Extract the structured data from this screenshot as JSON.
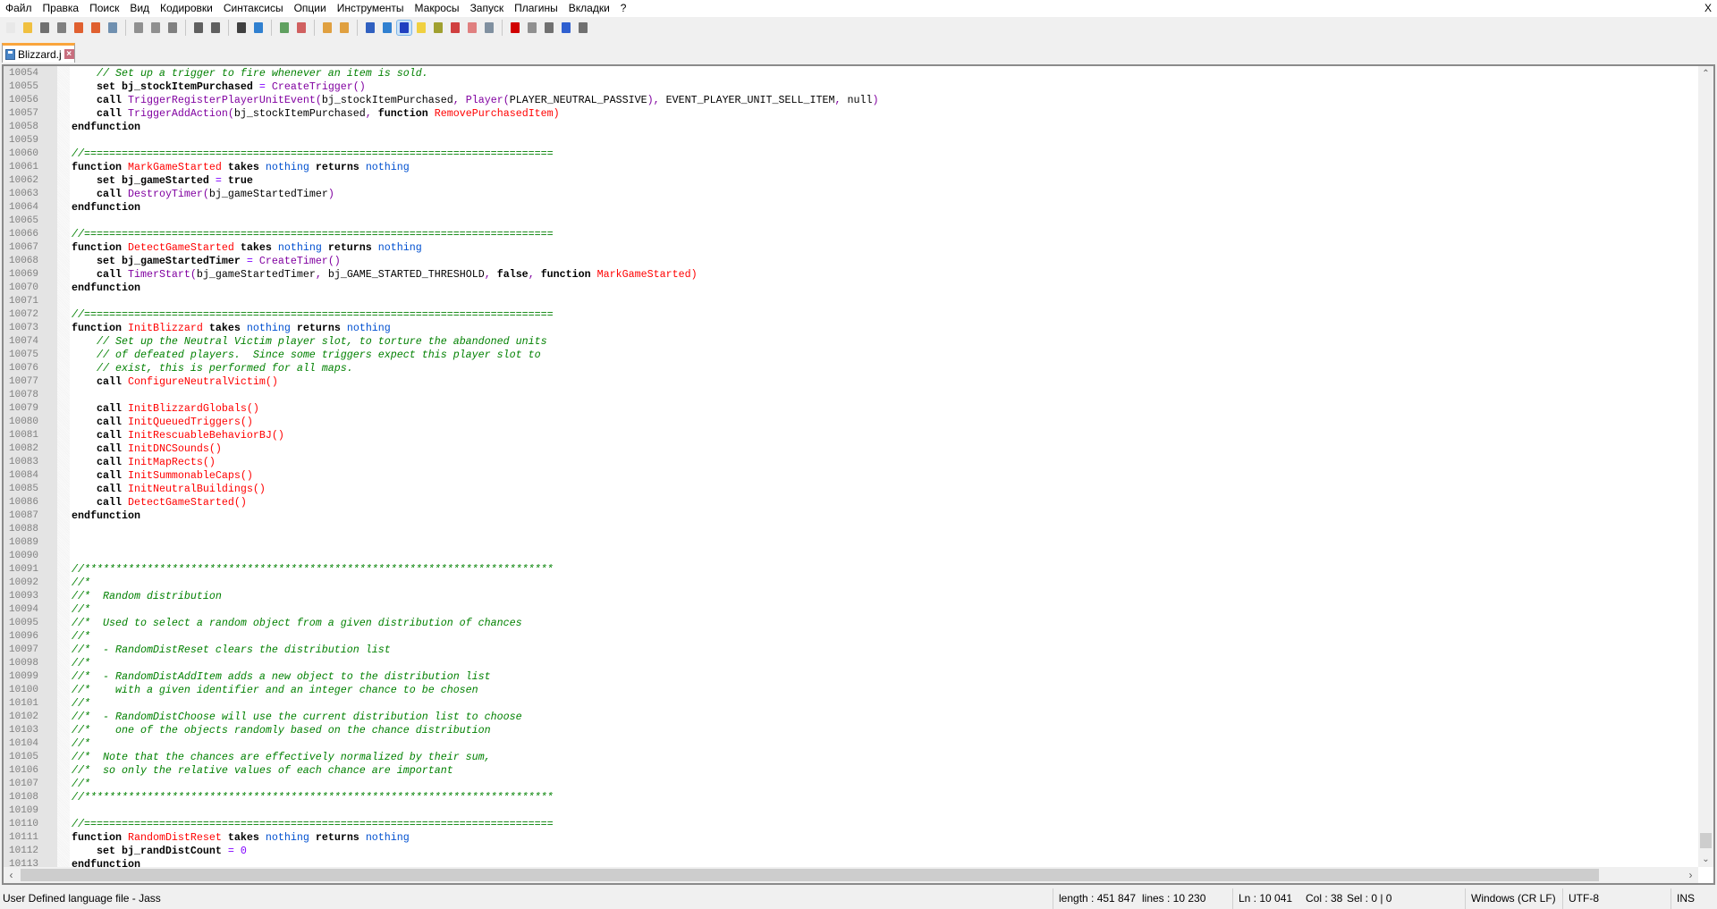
{
  "menu": [
    "Файл",
    "Правка",
    "Поиск",
    "Вид",
    "Кодировки",
    "Синтаксисы",
    "Опции",
    "Инструменты",
    "Макросы",
    "Запуск",
    "Плагины",
    "Вкладки",
    "?"
  ],
  "close_label": "X",
  "toolbar": [
    {
      "icon": "new-file-icon",
      "color": "#e8e8e8"
    },
    {
      "icon": "open-file-icon",
      "color": "#f0c040"
    },
    {
      "icon": "save-icon",
      "color": "#707070"
    },
    {
      "icon": "save-all-icon",
      "color": "#808080"
    },
    {
      "icon": "close-icon",
      "color": "#e06030"
    },
    {
      "icon": "close-all-icon",
      "color": "#e06030"
    },
    {
      "icon": "print-icon",
      "color": "#7090b0"
    },
    null,
    {
      "icon": "cut-icon",
      "color": "#909090"
    },
    {
      "icon": "copy-icon",
      "color": "#909090"
    },
    {
      "icon": "paste-icon",
      "color": "#808080"
    },
    null,
    {
      "icon": "undo-icon",
      "color": "#606060"
    },
    {
      "icon": "redo-icon",
      "color": "#606060"
    },
    null,
    {
      "icon": "find-icon",
      "color": "#404040"
    },
    {
      "icon": "replace-icon",
      "color": "#3080d0"
    },
    null,
    {
      "icon": "zoom-in-icon",
      "color": "#60a060"
    },
    {
      "icon": "zoom-out-icon",
      "color": "#d06060"
    },
    null,
    {
      "icon": "sync-vertical-icon",
      "color": "#e0a040"
    },
    {
      "icon": "sync-horizontal-icon",
      "color": "#e0a040"
    },
    null,
    {
      "icon": "word-wrap-icon",
      "color": "#3060c0"
    },
    {
      "icon": "show-all-chars-icon",
      "color": "#3080d0"
    },
    {
      "icon": "indent-guide-icon",
      "color": "#2040c0",
      "active": true
    },
    {
      "icon": "user-language-icon",
      "color": "#f0d040"
    },
    {
      "icon": "document-map-icon",
      "color": "#a0a030"
    },
    {
      "icon": "function-list-icon",
      "color": "#d04040"
    },
    {
      "icon": "folder-workspace-icon",
      "color": "#e08080"
    },
    {
      "icon": "monitoring-icon",
      "color": "#8090a0"
    },
    null,
    {
      "icon": "record-macro-icon",
      "color": "#d00000"
    },
    {
      "icon": "stop-macro-icon",
      "color": "#909090"
    },
    {
      "icon": "play-macro-icon",
      "color": "#707070"
    },
    {
      "icon": "run-macro-multiple-icon",
      "color": "#3060d0"
    },
    {
      "icon": "save-macro-icon",
      "color": "#707070"
    }
  ],
  "tab": {
    "label": "Blizzard.j"
  },
  "code_colors": {
    "keyword": "#000000",
    "native": "#8000a0",
    "user_function": "#ff0000",
    "type": "#0050d0",
    "comment": "#008000"
  },
  "lines": [
    {
      "n": "10054",
      "tokens": [
        [
          "    ",
          "p"
        ],
        [
          "// Set up a trigger to fire whenever an item is sold.",
          "c"
        ]
      ]
    },
    {
      "n": "10055",
      "tokens": [
        [
          "    set bj_stockItemPurchased ",
          "k"
        ],
        [
          "=",
          "o"
        ],
        [
          " ",
          "p"
        ],
        [
          "CreateTrigger",
          "n"
        ],
        [
          "()",
          "n"
        ]
      ]
    },
    {
      "n": "10056",
      "tokens": [
        [
          "    call ",
          "k"
        ],
        [
          "TriggerRegisterPlayerUnitEvent",
          "n"
        ],
        [
          "(",
          "n"
        ],
        [
          "bj_stockItemPurchased",
          "p"
        ],
        [
          ", ",
          "n"
        ],
        [
          "Player",
          "n"
        ],
        [
          "(",
          "n"
        ],
        [
          "PLAYER_NEUTRAL_PASSIVE",
          "p"
        ],
        [
          "), ",
          "n"
        ],
        [
          "EVENT_PLAYER_UNIT_SELL_ITEM",
          "p"
        ],
        [
          ", ",
          "n"
        ],
        [
          "null",
          "p"
        ],
        [
          ")",
          "n"
        ]
      ]
    },
    {
      "n": "10057",
      "tokens": [
        [
          "    call ",
          "k"
        ],
        [
          "TriggerAddAction",
          "n"
        ],
        [
          "(",
          "n"
        ],
        [
          "bj_stockItemPurchased",
          "p"
        ],
        [
          ", ",
          "n"
        ],
        [
          "function ",
          "k"
        ],
        [
          "RemovePurchasedItem",
          "u"
        ],
        [
          ")",
          "u"
        ]
      ]
    },
    {
      "n": "10058",
      "tokens": [
        [
          "endfunction",
          "k"
        ]
      ]
    },
    {
      "n": "10059",
      "tokens": []
    },
    {
      "n": "10060",
      "tokens": [
        [
          "//===========================================================================",
          "c"
        ]
      ]
    },
    {
      "n": "10061",
      "tokens": [
        [
          "function ",
          "k"
        ],
        [
          "MarkGameStarted",
          "u"
        ],
        [
          " takes ",
          "k"
        ],
        [
          "nothing",
          "t"
        ],
        [
          " returns ",
          "k"
        ],
        [
          "nothing",
          "t"
        ]
      ]
    },
    {
      "n": "10062",
      "tokens": [
        [
          "    set bj_gameStarted ",
          "k"
        ],
        [
          "=",
          "o"
        ],
        [
          " true",
          "k"
        ]
      ]
    },
    {
      "n": "10063",
      "tokens": [
        [
          "    call ",
          "k"
        ],
        [
          "DestroyTimer",
          "n"
        ],
        [
          "(",
          "n"
        ],
        [
          "bj_gameStartedTimer",
          "p"
        ],
        [
          ")",
          "n"
        ]
      ]
    },
    {
      "n": "10064",
      "tokens": [
        [
          "endfunction",
          "k"
        ]
      ]
    },
    {
      "n": "10065",
      "tokens": []
    },
    {
      "n": "10066",
      "tokens": [
        [
          "//===========================================================================",
          "c"
        ]
      ]
    },
    {
      "n": "10067",
      "tokens": [
        [
          "function ",
          "k"
        ],
        [
          "DetectGameStarted",
          "u"
        ],
        [
          " takes ",
          "k"
        ],
        [
          "nothing",
          "t"
        ],
        [
          " returns ",
          "k"
        ],
        [
          "nothing",
          "t"
        ]
      ]
    },
    {
      "n": "10068",
      "tokens": [
        [
          "    set bj_gameStartedTimer ",
          "k"
        ],
        [
          "=",
          "o"
        ],
        [
          " ",
          "p"
        ],
        [
          "CreateTimer",
          "n"
        ],
        [
          "()",
          "n"
        ]
      ]
    },
    {
      "n": "10069",
      "tokens": [
        [
          "    call ",
          "k"
        ],
        [
          "TimerStart",
          "n"
        ],
        [
          "(",
          "n"
        ],
        [
          "bj_gameStartedTimer",
          "p"
        ],
        [
          ", ",
          "n"
        ],
        [
          "bj_GAME_STARTED_THRESHOLD",
          "p"
        ],
        [
          ", ",
          "n"
        ],
        [
          "false",
          "k"
        ],
        [
          ", ",
          "n"
        ],
        [
          "function ",
          "k"
        ],
        [
          "MarkGameStarted",
          "u"
        ],
        [
          ")",
          "u"
        ]
      ]
    },
    {
      "n": "10070",
      "tokens": [
        [
          "endfunction",
          "k"
        ]
      ]
    },
    {
      "n": "10071",
      "tokens": []
    },
    {
      "n": "10072",
      "tokens": [
        [
          "//===========================================================================",
          "c"
        ]
      ]
    },
    {
      "n": "10073",
      "tokens": [
        [
          "function ",
          "k"
        ],
        [
          "InitBlizzard",
          "u"
        ],
        [
          " takes ",
          "k"
        ],
        [
          "nothing",
          "t"
        ],
        [
          " returns ",
          "k"
        ],
        [
          "nothing",
          "t"
        ]
      ]
    },
    {
      "n": "10074",
      "tokens": [
        [
          "    ",
          "p"
        ],
        [
          "// Set up the Neutral Victim player slot, to torture the abandoned units",
          "c"
        ]
      ]
    },
    {
      "n": "10075",
      "tokens": [
        [
          "    ",
          "p"
        ],
        [
          "// of defeated players.  Since some triggers expect this player slot to",
          "c"
        ]
      ]
    },
    {
      "n": "10076",
      "tokens": [
        [
          "    ",
          "p"
        ],
        [
          "// exist, this is performed for all maps.",
          "c"
        ]
      ]
    },
    {
      "n": "10077",
      "tokens": [
        [
          "    call ",
          "k"
        ],
        [
          "ConfigureNeutralVictim",
          "u"
        ],
        [
          "()",
          "u"
        ]
      ]
    },
    {
      "n": "10078",
      "tokens": []
    },
    {
      "n": "10079",
      "tokens": [
        [
          "    call ",
          "k"
        ],
        [
          "InitBlizzardGlobals",
          "u"
        ],
        [
          "()",
          "u"
        ]
      ]
    },
    {
      "n": "10080",
      "tokens": [
        [
          "    call ",
          "k"
        ],
        [
          "InitQueuedTriggers",
          "u"
        ],
        [
          "()",
          "u"
        ]
      ]
    },
    {
      "n": "10081",
      "tokens": [
        [
          "    call ",
          "k"
        ],
        [
          "InitRescuableBehaviorBJ",
          "u"
        ],
        [
          "()",
          "u"
        ]
      ]
    },
    {
      "n": "10082",
      "tokens": [
        [
          "    call ",
          "k"
        ],
        [
          "InitDNCSounds",
          "u"
        ],
        [
          "()",
          "u"
        ]
      ]
    },
    {
      "n": "10083",
      "tokens": [
        [
          "    call ",
          "k"
        ],
        [
          "InitMapRects",
          "u"
        ],
        [
          "()",
          "u"
        ]
      ]
    },
    {
      "n": "10084",
      "tokens": [
        [
          "    call ",
          "k"
        ],
        [
          "InitSummonableCaps",
          "u"
        ],
        [
          "()",
          "u"
        ]
      ]
    },
    {
      "n": "10085",
      "tokens": [
        [
          "    call ",
          "k"
        ],
        [
          "InitNeutralBuildings",
          "u"
        ],
        [
          "()",
          "u"
        ]
      ]
    },
    {
      "n": "10086",
      "tokens": [
        [
          "    call ",
          "k"
        ],
        [
          "DetectGameStarted",
          "u"
        ],
        [
          "()",
          "u"
        ]
      ]
    },
    {
      "n": "10087",
      "tokens": [
        [
          "endfunction",
          "k"
        ]
      ]
    },
    {
      "n": "10088",
      "tokens": []
    },
    {
      "n": "10089",
      "tokens": []
    },
    {
      "n": "10090",
      "tokens": []
    },
    {
      "n": "10091",
      "tokens": [
        [
          "//***************************************************************************",
          "c"
        ]
      ]
    },
    {
      "n": "10092",
      "tokens": [
        [
          "//*",
          "c"
        ]
      ]
    },
    {
      "n": "10093",
      "tokens": [
        [
          "//*  Random distribution",
          "c"
        ]
      ]
    },
    {
      "n": "10094",
      "tokens": [
        [
          "//*",
          "c"
        ]
      ]
    },
    {
      "n": "10095",
      "tokens": [
        [
          "//*  Used to select a random object from a given distribution of chances",
          "c"
        ]
      ]
    },
    {
      "n": "10096",
      "tokens": [
        [
          "//*",
          "c"
        ]
      ]
    },
    {
      "n": "10097",
      "tokens": [
        [
          "//*  - RandomDistReset clears the distribution list",
          "c"
        ]
      ]
    },
    {
      "n": "10098",
      "tokens": [
        [
          "//*",
          "c"
        ]
      ]
    },
    {
      "n": "10099",
      "tokens": [
        [
          "//*  - RandomDistAddItem adds a new object to the distribution list",
          "c"
        ]
      ]
    },
    {
      "n": "10100",
      "tokens": [
        [
          "//*    with a given identifier and an integer chance to be chosen",
          "c"
        ]
      ]
    },
    {
      "n": "10101",
      "tokens": [
        [
          "//*",
          "c"
        ]
      ]
    },
    {
      "n": "10102",
      "tokens": [
        [
          "//*  - RandomDistChoose will use the current distribution list to choose",
          "c"
        ]
      ]
    },
    {
      "n": "10103",
      "tokens": [
        [
          "//*    one of the objects randomly based on the chance distribution",
          "c"
        ]
      ]
    },
    {
      "n": "10104",
      "tokens": [
        [
          "//*",
          "c"
        ]
      ]
    },
    {
      "n": "10105",
      "tokens": [
        [
          "//*  Note that the chances are effectively normalized by their sum,",
          "c"
        ]
      ]
    },
    {
      "n": "10106",
      "tokens": [
        [
          "//*  so only the relative values of each chance are important",
          "c"
        ]
      ]
    },
    {
      "n": "10107",
      "tokens": [
        [
          "//*",
          "c"
        ]
      ]
    },
    {
      "n": "10108",
      "tokens": [
        [
          "//***************************************************************************",
          "c"
        ]
      ]
    },
    {
      "n": "10109",
      "tokens": []
    },
    {
      "n": "10110",
      "tokens": [
        [
          "//===========================================================================",
          "c"
        ]
      ]
    },
    {
      "n": "10111",
      "tokens": [
        [
          "function ",
          "k"
        ],
        [
          "RandomDistReset",
          "u"
        ],
        [
          " takes ",
          "k"
        ],
        [
          "nothing",
          "t"
        ],
        [
          " returns ",
          "k"
        ],
        [
          "nothing",
          "t"
        ]
      ]
    },
    {
      "n": "10112",
      "tokens": [
        [
          "    set bj_randDistCount ",
          "k"
        ],
        [
          "=",
          "o"
        ],
        [
          " ",
          "p"
        ],
        [
          "0",
          "o"
        ]
      ]
    },
    {
      "n": "10113",
      "tokens": [
        [
          "endfunction",
          "k"
        ]
      ]
    }
  ],
  "scroll": {
    "up": "⌃",
    "down": "⌄",
    "left": "‹",
    "right": "›",
    "vertical_position": 0.98
  },
  "status": {
    "language": "User Defined language file - Jass",
    "length": "length : 451 847",
    "lines": "lines : 10 230",
    "ln": "Ln : 10 041",
    "col": "Col : 38",
    "sel": "Sel : 0 | 0",
    "eol": "Windows (CR LF)",
    "encoding": "UTF-8",
    "mode": "INS"
  }
}
